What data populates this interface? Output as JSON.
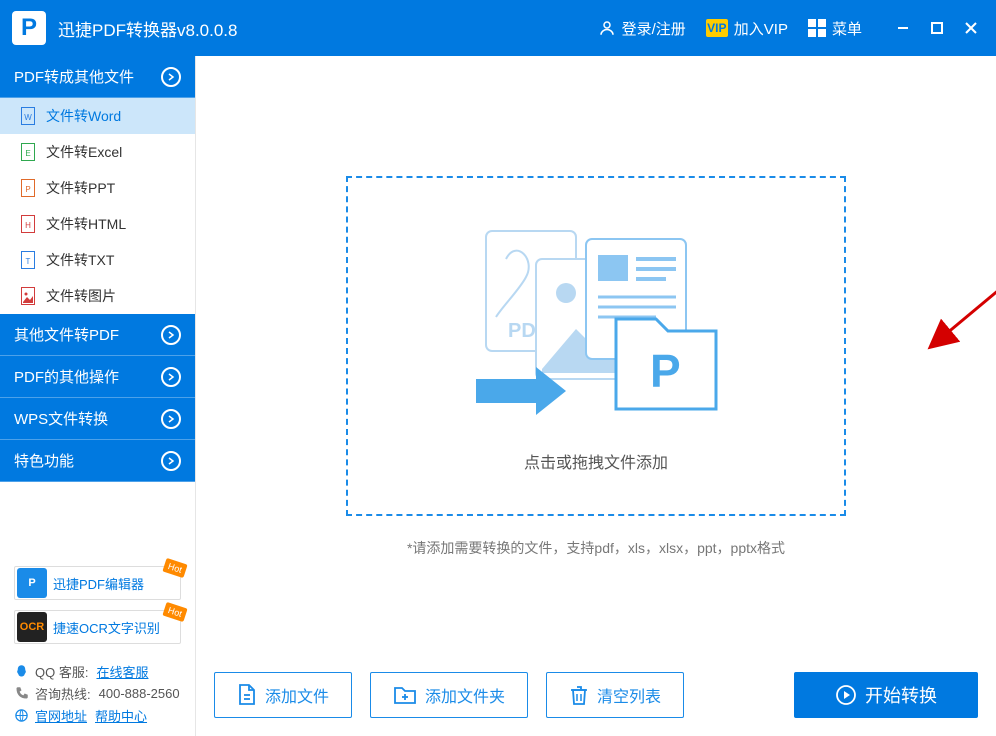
{
  "header": {
    "appTitle": "迅捷PDF转换器v8.0.0.8",
    "login": "登录/注册",
    "vip": "加入VIP",
    "menu": "菜单"
  },
  "sidebar": {
    "sections": [
      {
        "title": "PDF转成其他文件"
      },
      {
        "title": "其他文件转PDF"
      },
      {
        "title": "PDF的其他操作"
      },
      {
        "title": "WPS文件转换"
      },
      {
        "title": "特色功能"
      }
    ],
    "items": [
      {
        "label": "文件转Word",
        "iconColor": "#2a7de1"
      },
      {
        "label": "文件转Excel",
        "iconColor": "#2fa84f"
      },
      {
        "label": "文件转PPT",
        "iconColor": "#e06a2a"
      },
      {
        "label": "文件转HTML",
        "iconColor": "#d23c3c"
      },
      {
        "label": "文件转TXT",
        "iconColor": "#2a7de1"
      },
      {
        "label": "文件转图片",
        "iconColor": "#d23c3c"
      }
    ],
    "promos": [
      {
        "label": "迅捷PDF编辑器",
        "iconBg": "#1a8be8",
        "iconText": "P"
      },
      {
        "label": "捷速OCR文字识别",
        "iconBg": "#222",
        "iconText": "OCR"
      }
    ],
    "hotTag": "Hot",
    "footer": {
      "qqLabel": "QQ 客服:",
      "qqLink": "在线客服",
      "hotlineLabel": "咨询热线:",
      "hotlineValue": "400-888-2560",
      "siteLink": "官网地址",
      "helpLink": "帮助中心"
    }
  },
  "main": {
    "dropTitle": "点击或拖拽文件添加",
    "dropHint": "*请添加需要转换的文件，支持pdf，xls，xlsx，ppt，pptx格式"
  },
  "buttons": {
    "addFile": "添加文件",
    "addFolder": "添加文件夹",
    "clearList": "清空列表",
    "start": "开始转换"
  }
}
